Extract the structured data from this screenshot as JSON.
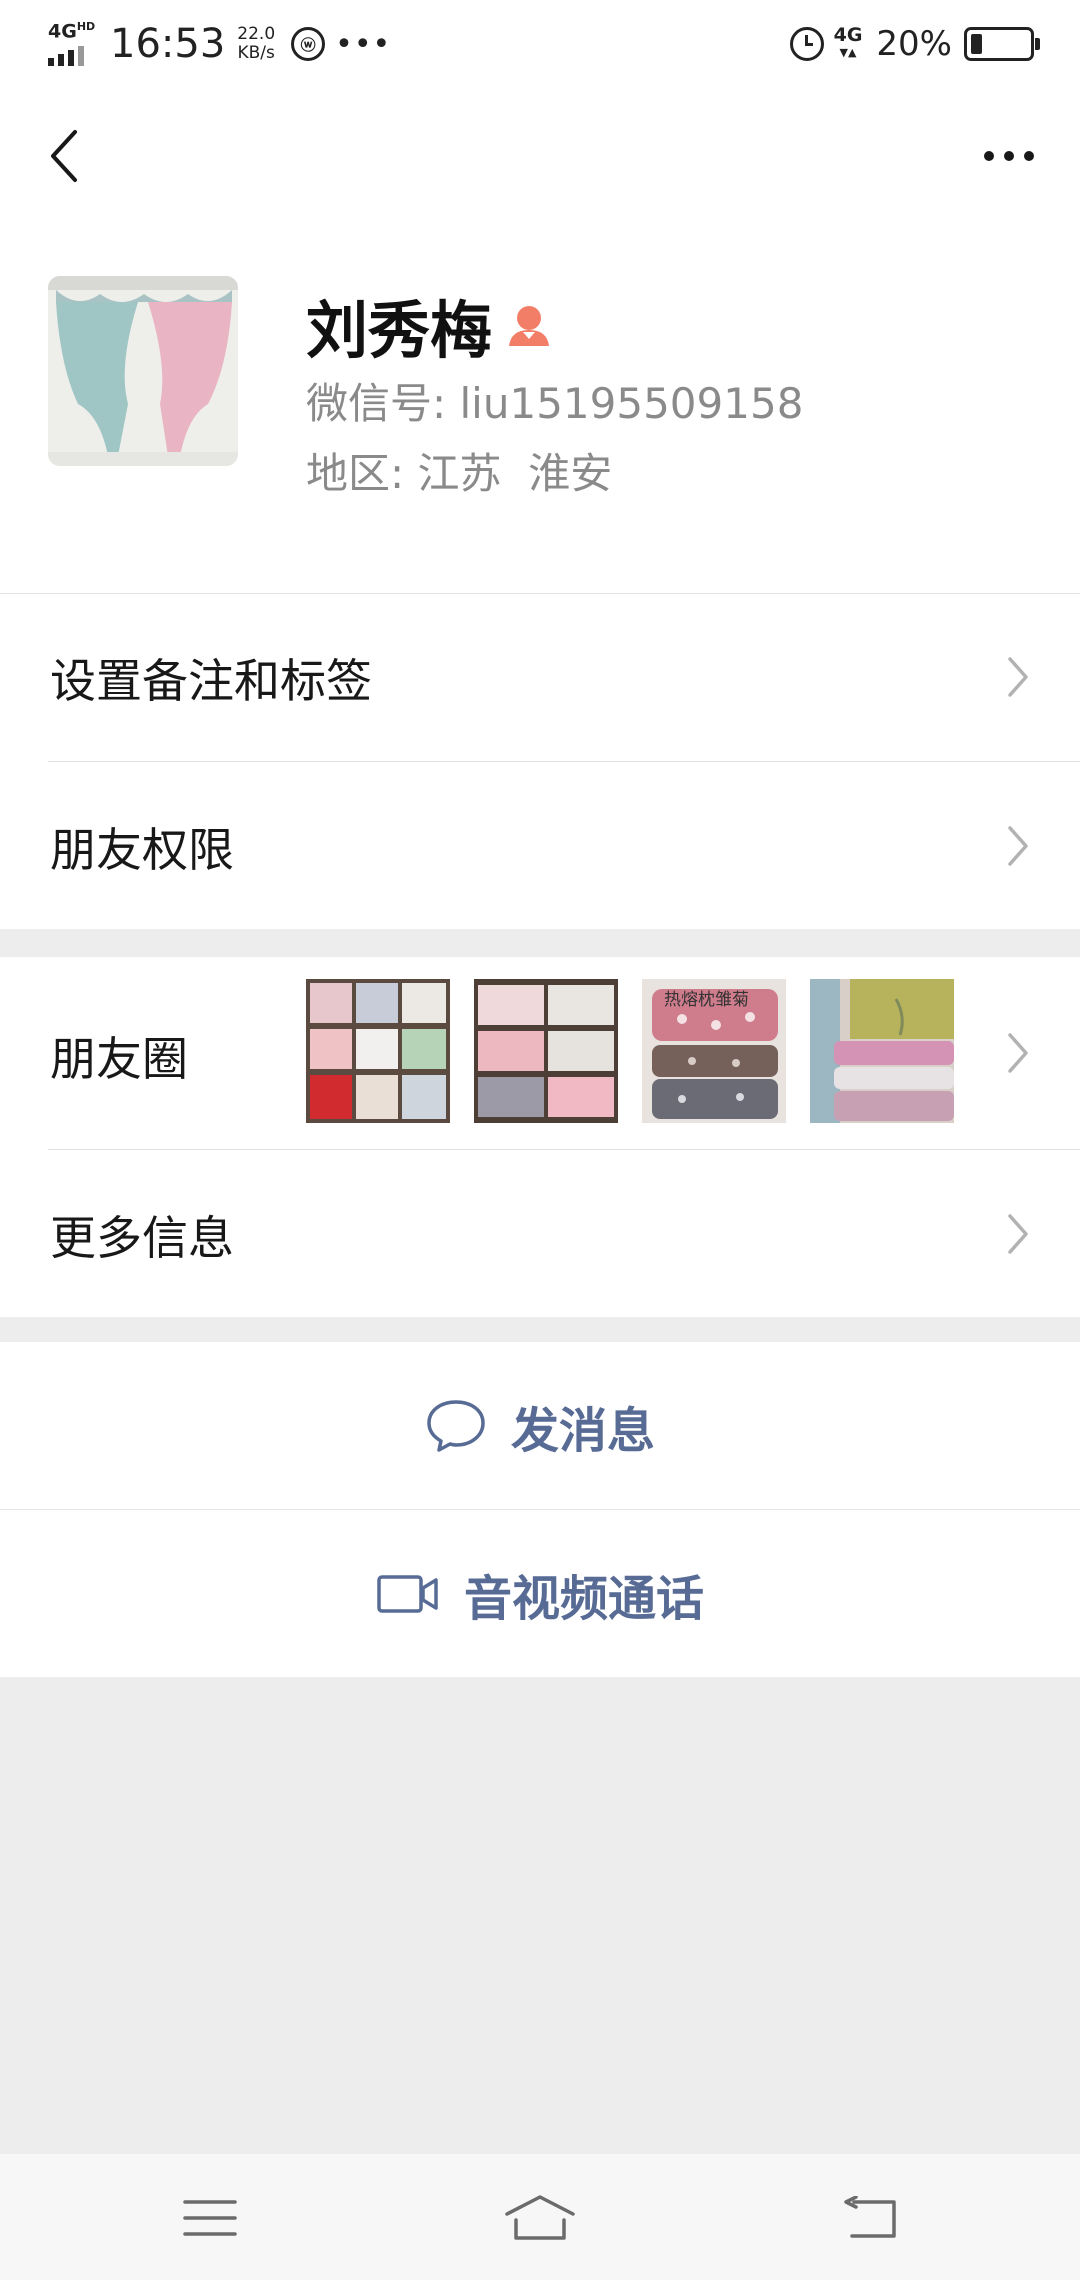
{
  "status_bar": {
    "network_left": "4G",
    "network_left_sup": "HD",
    "time": "16:53",
    "speed_value": "22.0",
    "speed_unit": "KB/s",
    "network_right": "4G",
    "battery_text": "20%",
    "battery_level": 0.2
  },
  "nav": {
    "back_icon": "chevron-left-icon",
    "more_icon": "more-dots-icon"
  },
  "profile": {
    "name": "刘秀梅",
    "gender_icon": "female-user-icon",
    "gender_color": "#f37e68",
    "wechat_id_label": "微信号:",
    "wechat_id": "liu15195509158",
    "region_label": "地区:",
    "region": "江苏  淮安"
  },
  "menu": {
    "remark_tags": "设置备注和标签",
    "friend_permissions": "朋友权限",
    "moments": "朋友圈",
    "more_info": "更多信息"
  },
  "moments_thumbnails": [
    {
      "icon": "pillow-grid-photo"
    },
    {
      "icon": "pillow-stack-photo"
    },
    {
      "icon": "pillow-floral-photo",
      "caption": "热熔枕雏菊"
    },
    {
      "icon": "pillow-fabric-photo"
    }
  ],
  "actions": {
    "send_message": "发消息",
    "video_call": "音视频通话",
    "accent_color": "#576b95"
  },
  "system_nav": {
    "menu_icon": "menu-icon",
    "home_icon": "home-icon",
    "back_icon": "back-icon"
  }
}
